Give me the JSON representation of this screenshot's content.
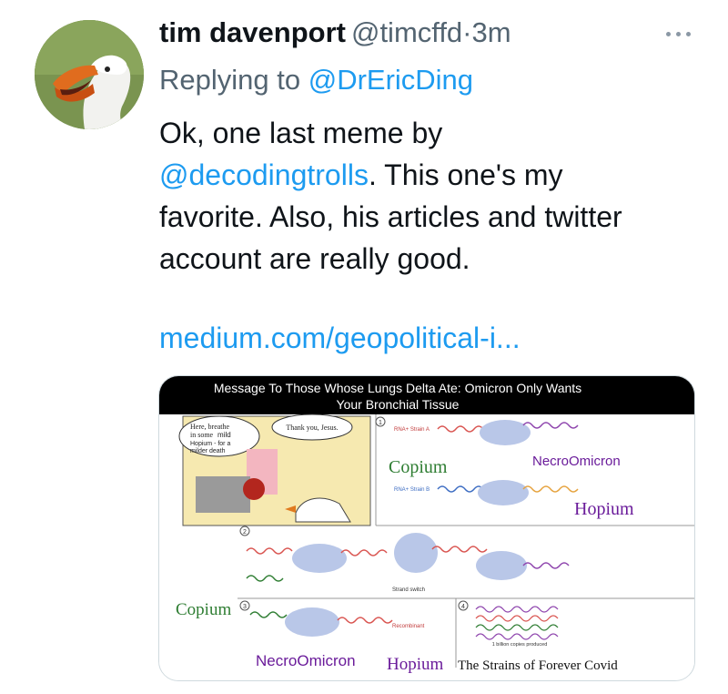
{
  "author": {
    "display_name": "tim davenport",
    "handle": "@timcffd",
    "separator": "·",
    "time": "3m"
  },
  "reply": {
    "prefix": "Replying to",
    "mention": "@DrEricDing"
  },
  "body": {
    "line1": "Ok, one last meme by",
    "mention": "@decodingtrolls",
    "line2_rest": ". This one's my",
    "line3": "favorite. Also, his articles and twitter",
    "line4": "account are really good.",
    "url": "medium.com/geopolitical-i..."
  },
  "meme": {
    "title_line1": "Message To Those Whose Lungs Delta Ate: Omicron Only Wants",
    "title_line2": "Your Bronchial Tissue",
    "bubble_left_1": "Here, breathe",
    "bubble_left_2": "in some",
    "bubble_left_mild": "mild",
    "bubble_left_3": "Hopium - for a",
    "bubble_left_4": "milder death",
    "bubble_right": "Thank you, Jesus.",
    "panel1": "1",
    "panel2": "2",
    "panel3": "3",
    "panel4": "4",
    "rna_a": "RNA+ Strain A",
    "rna_b": "RNA+ Strain B",
    "copium_top": "Copium",
    "necro_top": "NecroOmicron",
    "hopium_top": "Hopium",
    "strand_switch": "Strand switch",
    "copium_left": "Copium",
    "recombinant": "Recombinant",
    "billion": "1 billion copies produced",
    "necro_bottom": "NecroOmicron",
    "hopium_bottom": "Hopium",
    "caption": "The Strains of Forever Covid"
  },
  "colors": {
    "link": "#1d9bf0",
    "secondary_text": "#536471",
    "primary_text": "#0f1419",
    "meme_purple": "#6a1b9a",
    "meme_green": "#2e7d32"
  },
  "icons": {
    "more": "more-dots-icon",
    "avatar": "goose-avatar"
  }
}
